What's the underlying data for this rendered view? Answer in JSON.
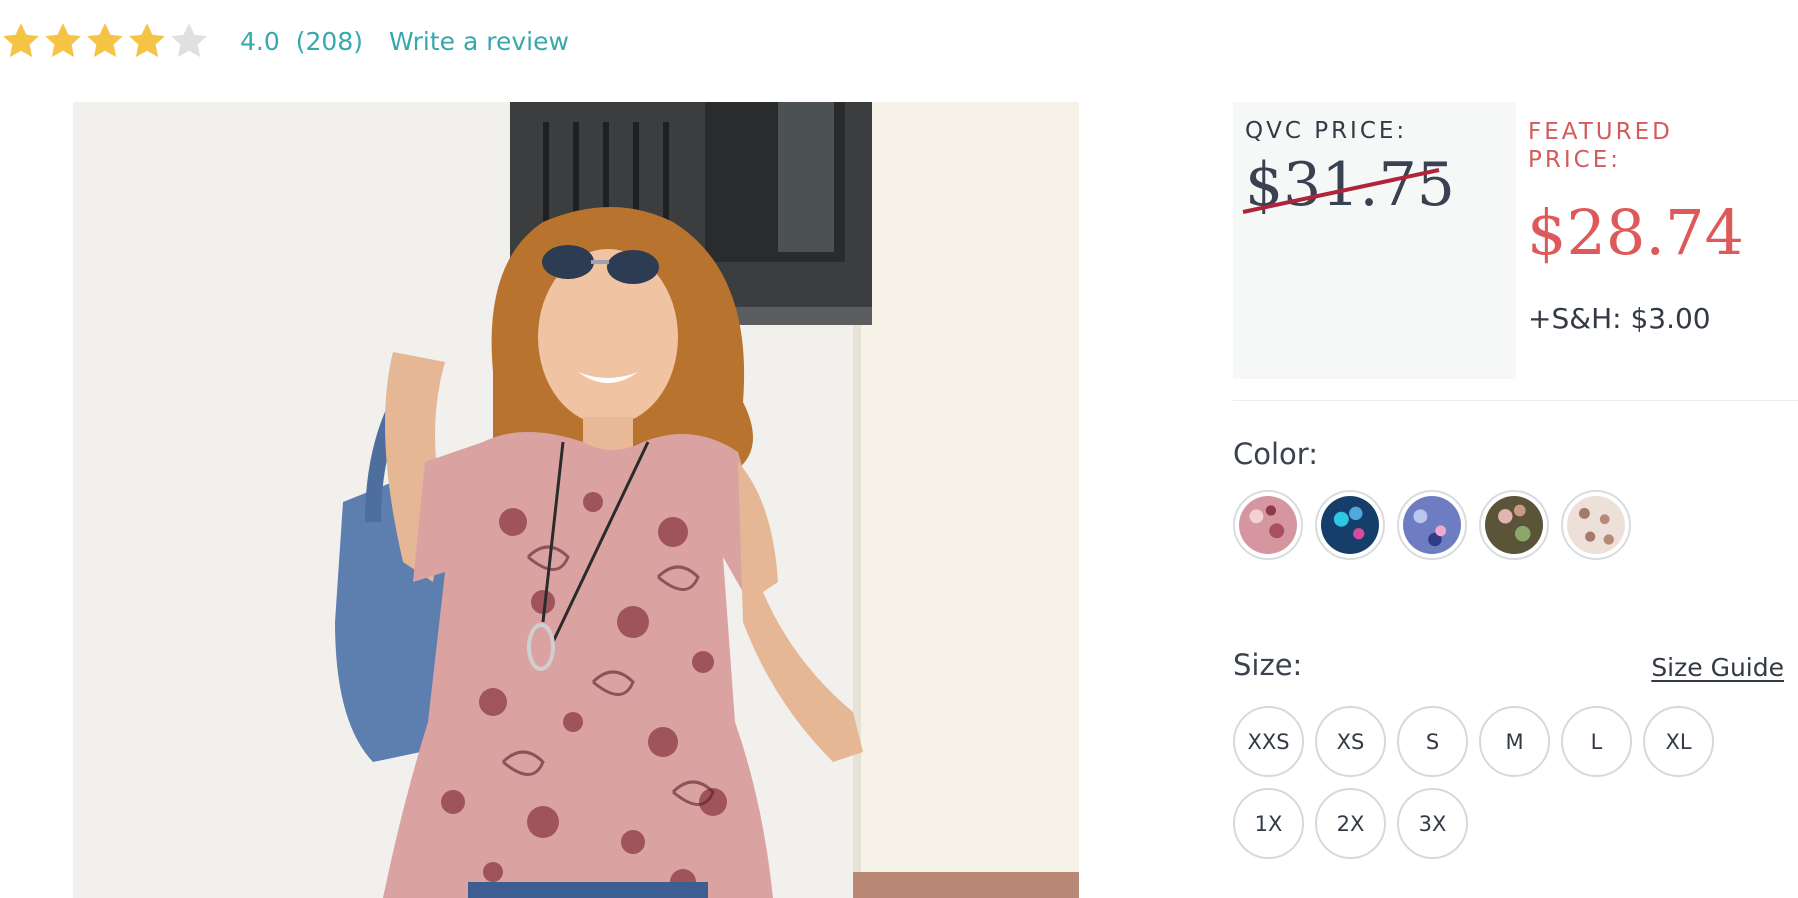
{
  "rating": {
    "value": "4.0",
    "count": "(208)",
    "stars_filled": 4,
    "stars_total": 5,
    "write_review_label": "Write a review",
    "star_color": "#f6c445",
    "star_empty_color": "#e0e0e0"
  },
  "product_image": {
    "alt": "Woman in pink paisley print top carrying a blue tote bag"
  },
  "pricing": {
    "qvc_label": "QVC PRICE:",
    "qvc_price": "$31.75",
    "featured_label": "FEATURED PRICE:",
    "featured_price": "$28.74",
    "shipping": "+S&H: $3.00",
    "accent_color": "#de5a5a"
  },
  "color": {
    "label": "Color:",
    "swatches": [
      {
        "name": "pink-floral",
        "bg": "#c98a92"
      },
      {
        "name": "navy-teal-floral",
        "bg": "#1e4f7a"
      },
      {
        "name": "periwinkle-floral",
        "bg": "#6a77b8"
      },
      {
        "name": "olive-floral",
        "bg": "#6f6a4c"
      },
      {
        "name": "taupe-dot",
        "bg": "#c9a99a"
      }
    ]
  },
  "size": {
    "label": "Size:",
    "guide_label": "Size Guide",
    "row1": [
      "XXS",
      "XS",
      "S",
      "M",
      "L",
      "XL"
    ],
    "row2": [
      "1X",
      "2X",
      "3X"
    ]
  }
}
